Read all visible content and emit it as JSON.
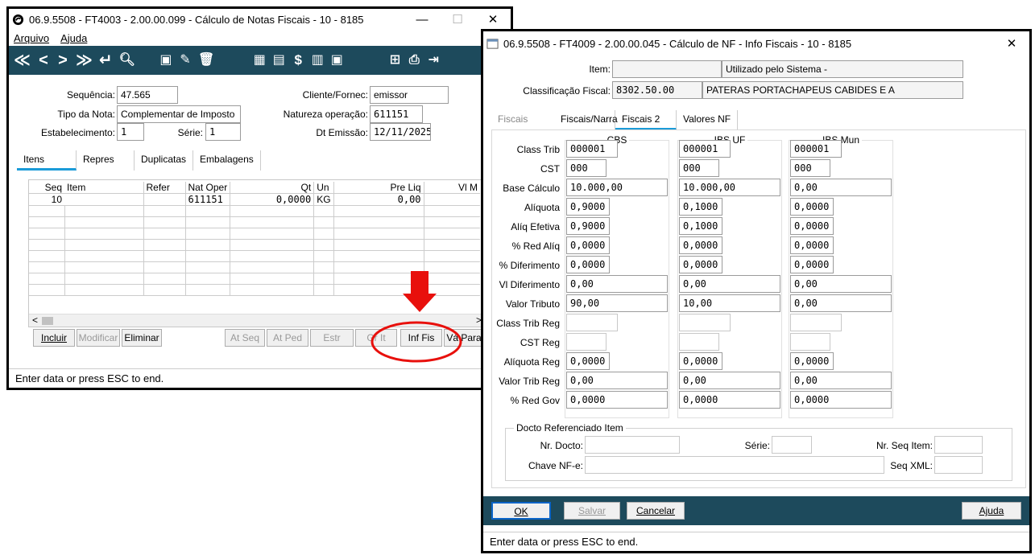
{
  "main_window": {
    "title": "06.9.5508 - FT4003 - 2.00.00.099 - Cálculo de Notas Fiscais - 10 - 8185",
    "minimize": "—",
    "maximize": "☐",
    "close": "✕",
    "menu": [
      "Arquivo",
      "Ajuda"
    ],
    "toolbar_icons": [
      "first-icon",
      "prev-icon",
      "next-icon",
      "last-icon",
      "enter-icon",
      "search-icon",
      "new-icon",
      "edit-icon",
      "delete-icon",
      "calculator-icon",
      "report-icon",
      "dollar-icon",
      "book-icon",
      "document-icon",
      "tree-icon",
      "print-icon",
      "exit-icon"
    ],
    "toolbar_glyphs": [
      "≪",
      "<",
      ">",
      "≫",
      "↵",
      "🔍︎",
      "▣",
      "✎",
      "🗑︎",
      "▦",
      "▤",
      "$",
      "▥",
      "▣",
      "⊞",
      "⎙",
      "⇥"
    ],
    "form": {
      "sequencia_label": "Sequência:",
      "sequencia": "47.565",
      "tipo_nota_label": "Tipo da Nota:",
      "tipo_nota": "Complementar de Imposto",
      "estabelecimento_label": "Estabelecimento:",
      "estabelecimento": "1",
      "serie_label": "Série:",
      "serie": "1",
      "cliente_label": "Cliente/Fornec:",
      "cliente": "emissor",
      "natureza_label": "Natureza operação:",
      "natureza": "611151",
      "dt_emissao_label": "Dt Emissão:",
      "dt_emissao": "12/11/2025"
    },
    "tabs": [
      "Itens",
      "Repres",
      "Duplicatas",
      "Embalagens"
    ],
    "grid": {
      "headers": [
        "Seq",
        "Item",
        "Refer",
        "Nat Oper",
        "Qt",
        "Un",
        "Pre Liq",
        "Vl M"
      ],
      "row": [
        "10",
        "",
        "",
        "611151",
        "0,0000",
        "KG",
        "0,00",
        ""
      ]
    },
    "buttons": [
      "Incluir",
      "Modificar",
      "Eliminar",
      "At Seq",
      "At Ped",
      "Estr",
      "Gr It",
      "Inf Fis",
      "Vá Para"
    ],
    "status": "Enter data or press ESC to end."
  },
  "dialog": {
    "title": "06.9.5508 - FT4009 - 2.00.00.045 - Cálculo de NF - Info Fiscais - 10 - 8185",
    "close": "✕",
    "item_label": "Item:",
    "item_value": "",
    "item_desc": "Utilizado pelo Sistema -",
    "class_fiscal_label": "Classificação Fiscal:",
    "class_fiscal": "8302.50.00",
    "class_desc": "PATERAS PORTACHAPEUS CABIDES E A",
    "tabs": [
      "Fiscais",
      "Fiscais/Narra",
      "Fiscais 2",
      "Valores NF"
    ],
    "row_labels": [
      "Class Trib",
      "CST",
      "Base Cálculo",
      "Alíquota",
      "Alíq Efetiva",
      "% Red Alíq",
      "% Diferimento",
      "Vl Diferimento",
      "Valor Tributo",
      "Class Trib Reg",
      "CST Reg",
      "Alíquota Reg",
      "Valor Trib Reg",
      "% Red Gov"
    ],
    "groups": [
      {
        "name": "CBS",
        "values": [
          "000001",
          "000",
          "10.000,00",
          "0,9000",
          "0,9000",
          "0,0000",
          "0,0000",
          "0,00",
          "90,00",
          "",
          "",
          "0,0000",
          "0,00",
          "0,0000"
        ]
      },
      {
        "name": "IBS UF",
        "values": [
          "000001",
          "000",
          "10.000,00",
          "0,1000",
          "0,1000",
          "0,0000",
          "0,0000",
          "0,00",
          "10,00",
          "",
          "",
          "0,0000",
          "0,00",
          "0,0000"
        ]
      },
      {
        "name": "IBS Mun",
        "values": [
          "000001",
          "000",
          "0,00",
          "0,0000",
          "0,0000",
          "0,0000",
          "0,0000",
          "0,00",
          "0,00",
          "",
          "",
          "0,0000",
          "0,00",
          "0,0000"
        ]
      }
    ],
    "docto": {
      "title": "Docto Referenciado Item",
      "nr_docto_label": "Nr. Docto:",
      "nr_docto": "",
      "serie_label": "Série:",
      "serie": "",
      "nr_seq_label": "Nr. Seq Item:",
      "nr_seq": "",
      "chave_label": "Chave NF-e:",
      "chave": "",
      "seq_xml_label": "Seq XML:",
      "seq_xml": ""
    },
    "buttons": {
      "ok": "OK",
      "salvar": "Salvar",
      "cancelar": "Cancelar",
      "ajuda": "Ajuda"
    },
    "status": "Enter data or press ESC to end."
  },
  "annotation": {
    "arrow_color": "#e8100c",
    "circle_color": "#e8100c"
  }
}
